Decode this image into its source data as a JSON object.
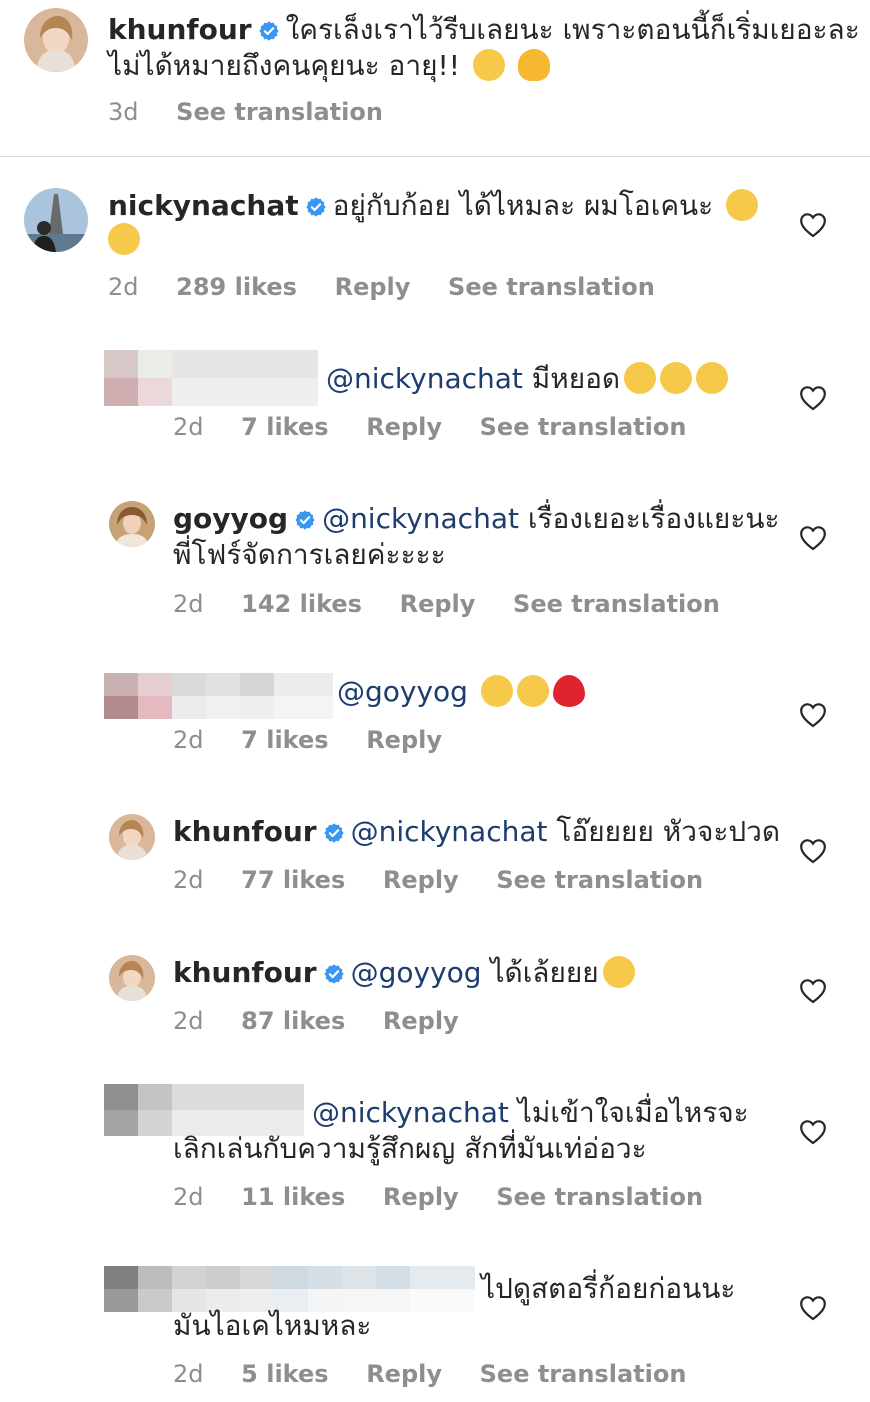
{
  "post_caption": {
    "username": "khunfour",
    "text_line1": "ใครเล็งเราไว้รีบเลยนะ เพราะตอนนี้ก็เริ่มเยอะละ",
    "text_line2": "ไม่ได้หมายถึงคนคุยนะ อายุ!!",
    "time": "3d",
    "see_translation": "See translation"
  },
  "comments": [
    {
      "username": "nickynachat",
      "text": "อยู่กับก้อย ได้ไหมละ ผมโอเคนะ",
      "time": "2d",
      "likes": "289 likes",
      "reply": "Reply",
      "see_translation": "See translation"
    },
    {
      "username": "",
      "mention": "@nickynachat",
      "text": "มีหยอด",
      "time": "2d",
      "likes": "7 likes",
      "reply": "Reply",
      "see_translation": "See translation"
    },
    {
      "username": "goyyog",
      "mention": "@nickynachat",
      "text_line1": "เรื่องเยอะเรื่องแยะนะ",
      "text_line2": "พี่โฟร์จัดการเลยค่ะะะะ",
      "time": "2d",
      "likes": "142 likes",
      "reply": "Reply",
      "see_translation": "See translation"
    },
    {
      "username": "",
      "mention": "@goyyog",
      "time": "2d",
      "likes": "7 likes",
      "reply": "Reply"
    },
    {
      "username": "khunfour",
      "mention": "@nickynachat",
      "text": "โอ๊ยยยย หัวจะปวด",
      "time": "2d",
      "likes": "77 likes",
      "reply": "Reply",
      "see_translation": "See translation"
    },
    {
      "username": "khunfour",
      "mention": "@goyyog",
      "text": "ได้เล้ยยย",
      "time": "2d",
      "likes": "87 likes",
      "reply": "Reply"
    },
    {
      "username": "",
      "mention": "@nickynachat",
      "text_line1": "ไม่เข้าใจเมื่อไหรจะ",
      "text_line2": "เลิกเล่นกับความรู้สึกผญ สักที่มันเท่อ่อวะ",
      "time": "2d",
      "likes": "11 likes",
      "reply": "Reply",
      "see_translation": "See translation"
    },
    {
      "username": "",
      "text_line1": "ไปดูสตอรี่ก้อยก่อนนะ",
      "text_line2": "มันไอเคไหมหละ",
      "time": "2d",
      "likes": "5 likes",
      "reply": "Reply",
      "see_translation": "See translation"
    }
  ],
  "colors": {
    "text": "#262626",
    "muted": "#8e8e8e",
    "mention": "#1c3d6e",
    "verified": "#3897f0"
  },
  "icons": [
    "verified-badge-icon",
    "heart-icon"
  ]
}
